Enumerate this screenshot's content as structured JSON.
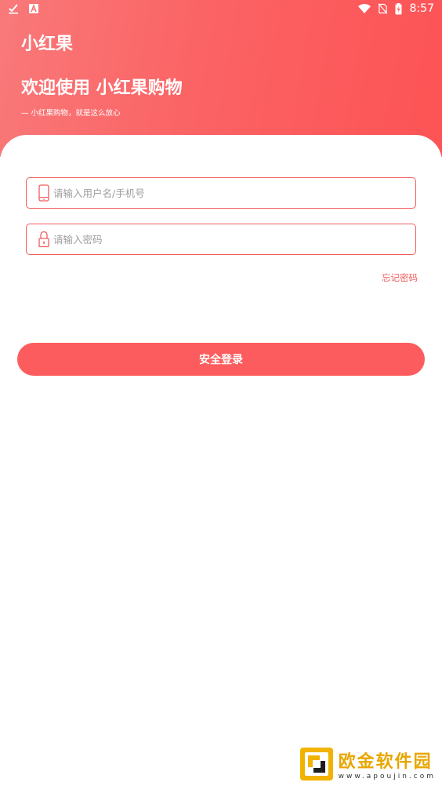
{
  "status_bar": {
    "time": "8:57",
    "icons": [
      "check-download-icon",
      "a-notification-icon",
      "wifi-icon",
      "no-sim-icon",
      "battery-charging-icon"
    ]
  },
  "header": {
    "app_title": "小红果",
    "welcome": "欢迎使用 小红果购物",
    "tagline": "— 小红果购物，就是这么放心"
  },
  "form": {
    "username": {
      "value": "",
      "placeholder": "请输入用户名/手机号",
      "icon": "phone-icon"
    },
    "password": {
      "value": "",
      "placeholder": "请输入密码",
      "icon": "lock-icon"
    },
    "forgot_label": "忘记密码",
    "login_label": "安全登录"
  },
  "watermark": {
    "name": "欧金软件园",
    "url": "www.apoujin.com"
  },
  "colors": {
    "accent": "#fc5c5d",
    "border": "#f25c5c",
    "header_start": "#f9797a",
    "header_end": "#fd5355"
  }
}
